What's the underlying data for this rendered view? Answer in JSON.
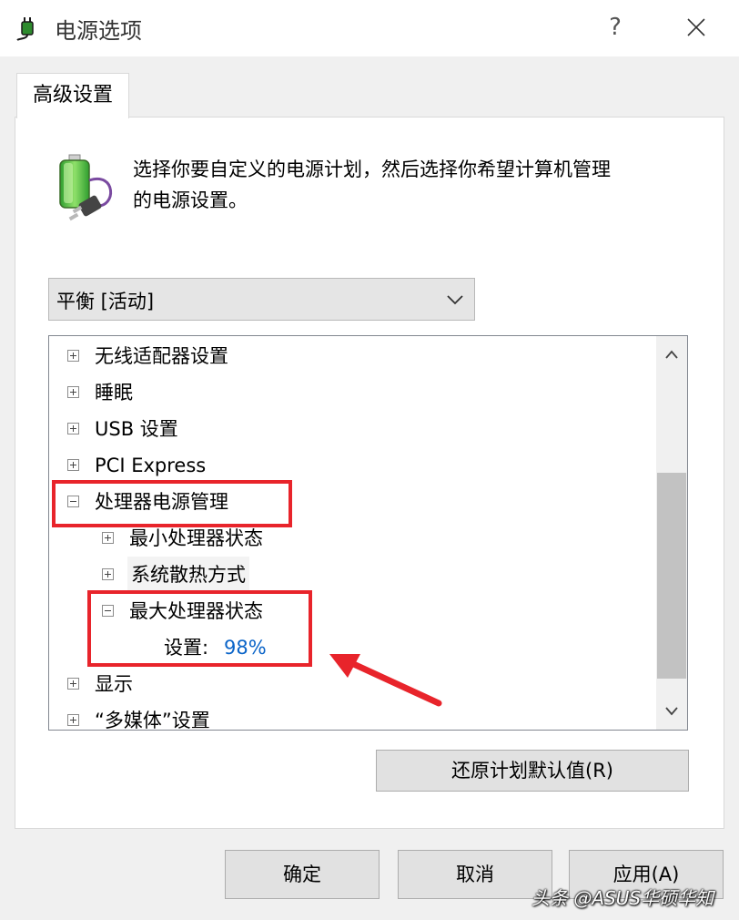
{
  "window": {
    "title": "电源选项",
    "help_label": "?",
    "icons": {
      "app": "power-plug-icon",
      "close": "close-icon",
      "help": "help-icon"
    }
  },
  "tabs": [
    {
      "label": "高级设置",
      "selected": true
    }
  ],
  "description": {
    "line1": "选择你要自定义的电源计划，然后选择你希望计算机管理",
    "line2": "的电源设置。",
    "icon": "battery-plug-icon"
  },
  "plan_select": {
    "value": "平衡 [活动]",
    "icon": "chevron-down-icon"
  },
  "tree": {
    "items": [
      {
        "label": "无线适配器设置",
        "expanded": false
      },
      {
        "label": "睡眠",
        "expanded": false
      },
      {
        "label": "USB 设置",
        "expanded": false
      },
      {
        "label": "PCI Express",
        "expanded": false
      },
      {
        "label": "处理器电源管理",
        "expanded": true,
        "children": [
          {
            "label": "最小处理器状态",
            "expanded": false
          },
          {
            "label": "系统散热方式",
            "expanded": false
          },
          {
            "label": "最大处理器状态",
            "expanded": true,
            "setting": {
              "label": "设置:",
              "value": "98%"
            }
          }
        ]
      },
      {
        "label": "显示",
        "expanded": false
      },
      {
        "label": "“多媒体”设置",
        "expanded": false
      }
    ]
  },
  "annotations": {
    "highlight_color": "#e8242b",
    "arrow": "red-arrow-icon"
  },
  "buttons": {
    "restore": "还原计划默认值(R)",
    "ok": "确定",
    "cancel": "取消",
    "apply": "应用(A)"
  },
  "watermark": "头条 @ASUS华硕华知",
  "colors": {
    "setting_value": "#0a64c8",
    "background": "#f0f0f0",
    "panel": "#ffffff"
  }
}
